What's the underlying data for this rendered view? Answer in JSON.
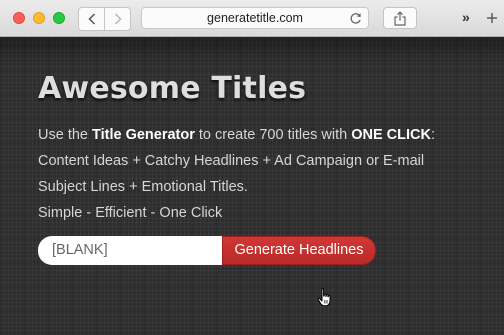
{
  "browser": {
    "url": "generatetitle.com",
    "overflow_label": "»"
  },
  "page": {
    "heading": "Awesome Titles",
    "description": {
      "line1_prefix": "Use the ",
      "line1_bold1": "Title Generator",
      "line1_mid": " to create 700 titles with ",
      "line1_bold2": "ONE CLICK",
      "line1_suffix": ":",
      "line2": "Content Ideas + Catchy Headlines + Ad Campaign or E-mail",
      "line3": "Subject Lines + Emotional Titles.",
      "line4": "Simple - Efficient - One Click"
    },
    "form": {
      "input_value": "[BLANK]",
      "button_label": "Generate Headlines"
    }
  },
  "colors": {
    "button": "#c8302e",
    "page_background": "#2e2e2e"
  },
  "icons": [
    "back-arrow-icon",
    "forward-arrow-icon",
    "reload-icon",
    "share-icon",
    "new-tab-plus-icon",
    "hand-cursor-icon"
  ]
}
